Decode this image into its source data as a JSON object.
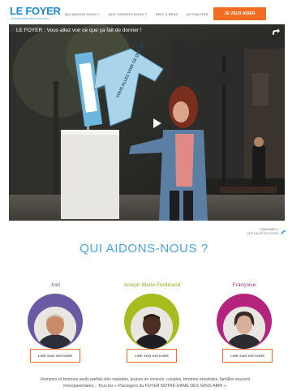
{
  "nav": {
    "logo_text": "LE FOYER",
    "logo_tagline": "NOTRE-DAME DES SANS-ABRI",
    "items": [
      {
        "label": "QUI AIDONS-NOUS ?"
      },
      {
        "label": "QUE FAISONS-NOUS ?"
      },
      {
        "label": "BRIC À BRAC"
      },
      {
        "label": "ACTUALITÉS"
      }
    ],
    "cta_label": "JE VEUX AIDER"
  },
  "video": {
    "title": "LE FOYER : Vous allez voir ce que ça fait de donner !",
    "sign_text": "VOUS ALLEZ VOIR CE QUE ÇA FAIT DE DONNER",
    "icons": [
      "share-icon",
      "play-icon"
    ]
  },
  "side_link": {
    "line1": "S'ABONNER À",
    "line2": "L'ACTUALITÉ DU FOYER"
  },
  "section": {
    "title": "QUI AIDONS-NOUS ?",
    "people": [
      {
        "name": "Joël",
        "name_color": "#6a5a8c",
        "ring_color": "#6c59a4",
        "button_label": "LIRE SON HISTOIRE"
      },
      {
        "name": "Joseph-Marie-Ferdinand",
        "name_color": "#98ad1e",
        "ring_color": "#a9bc1d",
        "button_label": "LIRE SON HISTOIRE"
      },
      {
        "name": "Françoise",
        "name_color": "#b32f7e",
        "ring_color": "#b4247f",
        "button_label": "LIRE SON HISTOIRE"
      }
    ],
    "description": "Hommes et femmes seuls parfois très malades, jeunes en errance, couples, femmes enceintes, familles souvent monoparentales... Tous les « Passagers du FOYER NOTRE-DAME DES SANS-ABRI »."
  },
  "colors": {
    "accent_blue": "#49a4df",
    "cta_orange": "#f26d21"
  }
}
